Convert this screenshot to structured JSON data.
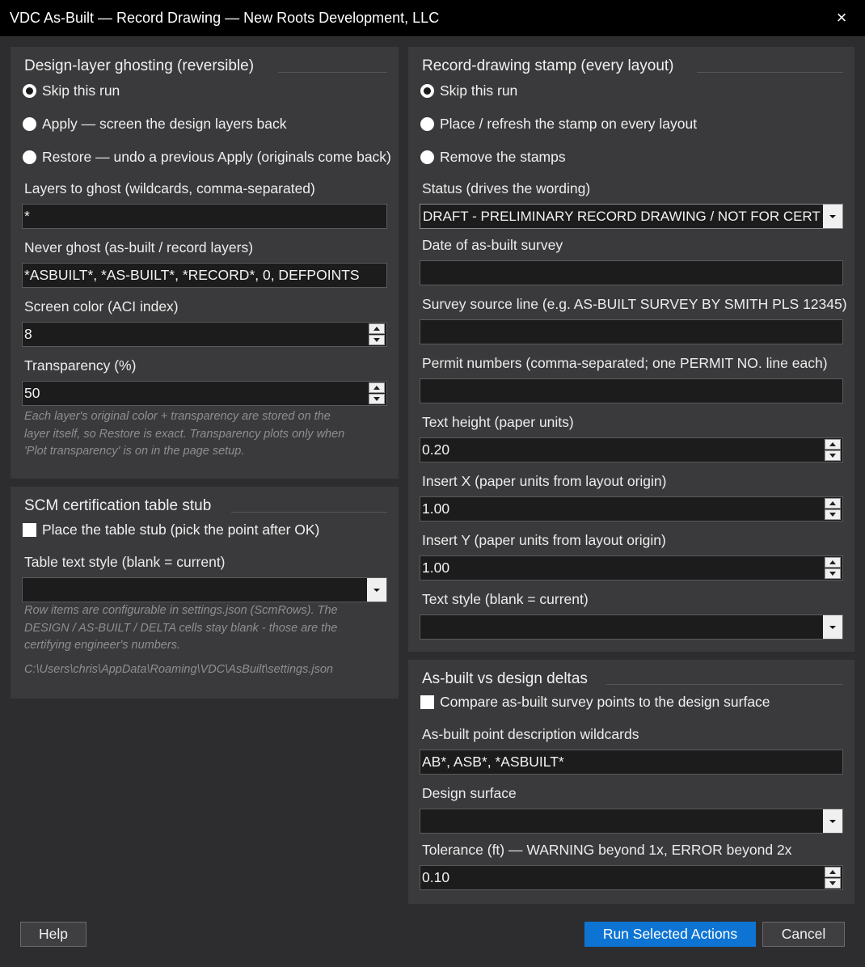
{
  "window": {
    "title": "VDC As-Built — Record Drawing — New Roots Development, LLC",
    "close_icon": "×"
  },
  "ghosting": {
    "title": "Design-layer ghosting (reversible)",
    "options": [
      {
        "label": "Skip this run",
        "selected": true
      },
      {
        "label": "Apply — screen the design layers back",
        "selected": false
      },
      {
        "label": "Restore — undo a previous Apply (originals come back)",
        "selected": false
      }
    ],
    "layers_label": "Layers to ghost (wildcards, comma-separated)",
    "layers_value": "*",
    "never_label": "Never ghost (as-built / record layers)",
    "never_value": "*ASBUILT*, *AS-BUILT*, *RECORD*, 0, DEFPOINTS",
    "color_label": "Screen color (ACI index)",
    "color_value": "8",
    "transparency_label": "Transparency (%)",
    "transparency_value": "50",
    "note_lines": [
      "Each layer's original color + transparency are stored on the",
      "layer itself, so Restore is exact. Transparency plots only when",
      "'Plot transparency' is on in the page setup."
    ]
  },
  "scm": {
    "title": "SCM certification table stub",
    "place_label": "Place the table stub (pick the point after OK)",
    "style_label": "Table text style (blank = current)",
    "style_value": "",
    "note_lines": [
      "Row items are configurable in settings.json (ScmRows). The",
      "DESIGN / AS-BUILT / DELTA cells stay blank - those are the",
      "certifying engineer's numbers."
    ],
    "settings_path": "C:\\Users\\chris\\AppData\\Roaming\\VDC\\AsBuilt\\settings.json"
  },
  "stamp": {
    "title": "Record-drawing stamp (every layout)",
    "options": [
      {
        "label": "Skip this run",
        "selected": true
      },
      {
        "label": "Place / refresh the stamp on every layout",
        "selected": false
      },
      {
        "label": "Remove the stamps",
        "selected": false
      }
    ],
    "status_label": "Status (drives the wording)",
    "status_value": "DRAFT - PRELIMINARY RECORD DRAWING / NOT FOR CERTIFICATION",
    "date_label": "Date of as-built survey",
    "date_value": "",
    "survey_label": "Survey source line (e.g. AS-BUILT SURVEY BY SMITH PLS 12345)",
    "survey_value": "",
    "permit_label": "Permit numbers (comma-separated; one PERMIT NO. line each)",
    "permit_value": "",
    "height_label": "Text height (paper units)",
    "height_value": "0.20",
    "x_label": "Insert X (paper units from layout origin)",
    "x_value": "1.00",
    "y_label": "Insert Y (paper units from layout origin)",
    "y_value": "1.00",
    "style_label": "Text style (blank = current)",
    "style_value": ""
  },
  "deltas": {
    "title": "As-built vs design deltas",
    "compare_label": "Compare as-built survey points to the design surface",
    "wildcards_label": "As-built point description wildcards",
    "wildcards_value": "AB*, ASB*, *ASBUILT*",
    "surface_label": "Design surface",
    "surface_value": "",
    "tolerance_label": "Tolerance (ft) — WARNING beyond 1x, ERROR beyond 2x",
    "tolerance_value": "0.10"
  },
  "buttons": {
    "help": "Help",
    "run": "Run Selected Actions",
    "cancel": "Cancel"
  }
}
